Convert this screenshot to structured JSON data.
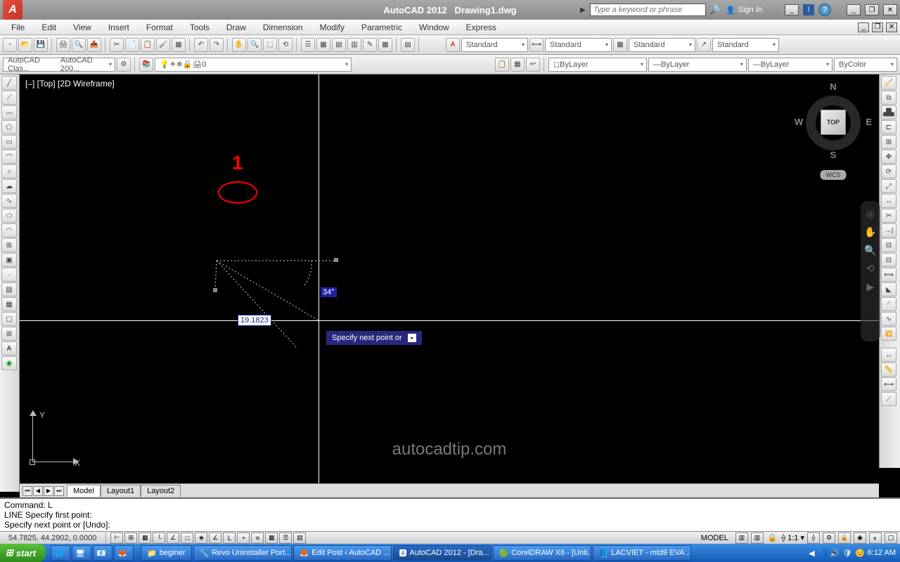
{
  "title": {
    "app": "AutoCAD 2012",
    "file": "Drawing1.dwg"
  },
  "search_placeholder": "Type a keyword or phrase",
  "signin": "Sign In",
  "menu": [
    "File",
    "Edit",
    "View",
    "Insert",
    "Format",
    "Tools",
    "Draw",
    "Dimension",
    "Modify",
    "Parametric",
    "Window",
    "Express"
  ],
  "workspace": {
    "current": "AutoCAD Clas...",
    "alt": "AutoCAD 200..."
  },
  "layer_dd": "0",
  "bylayer": "ByLayer",
  "bycolor": "ByColor",
  "standard": "Standard",
  "view_label": "[–] [Top] [2D Wireframe]",
  "viewcube": {
    "n": "N",
    "s": "S",
    "e": "E",
    "w": "W",
    "face": "TOP",
    "wcs": "WCS"
  },
  "annotation": {
    "num": "1",
    "dist": "19.1823",
    "angle": "34°"
  },
  "tooltip": {
    "text": "Specify next point or",
    "icon": "▾"
  },
  "watermark": "autocadtip.com",
  "ucs": {
    "x": "X",
    "y": "Y"
  },
  "tabs": {
    "model": "Model",
    "l1": "Layout1",
    "l2": "Layout2"
  },
  "cmd": {
    "l1": "Command: L",
    "l2": "LINE Specify first point:",
    "l3": "Specify next point or [Undo]:"
  },
  "coords": "54.7825, 44.2902, 0.0000",
  "status_model": "MODEL",
  "scale": "1:1",
  "taskbar": {
    "start": "start",
    "items": [
      "beginer",
      "Revo Uninstaller Port...",
      "Edit Post ‹ AutoCAD ...",
      "AutoCAD 2012 - [Dra...",
      "CorelDRAW X6 - [Unti...",
      "LACVIET - mtd9 EVA ..."
    ],
    "time": "6:12 AM"
  }
}
